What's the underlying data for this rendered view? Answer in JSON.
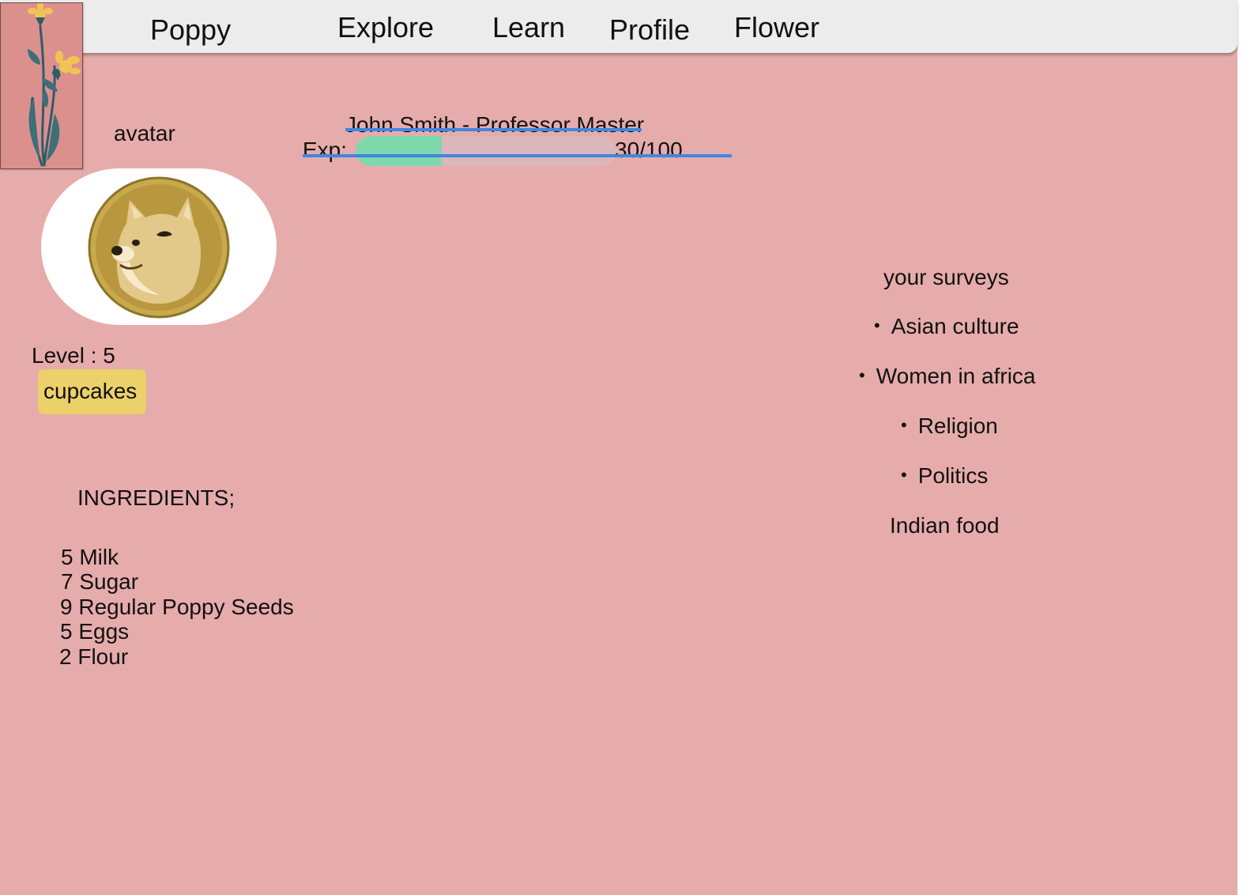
{
  "nav": {
    "brand": "Poppy",
    "items": [
      {
        "label": "Explore"
      },
      {
        "label": "Learn"
      },
      {
        "label": "Profile"
      },
      {
        "label": "Flower"
      }
    ]
  },
  "profile": {
    "avatar_label": "avatar",
    "name_title": "John Smith  - Professor Master",
    "exp_label": "Exp:",
    "exp_value": "30/100",
    "exp_fraction": 0.33,
    "level": "Level : 5",
    "badge": "cupcakes"
  },
  "ingredients": {
    "heading": "INGREDIENTS;",
    "items": [
      {
        "text": "5 Milk"
      },
      {
        "text": "7 Sugar"
      },
      {
        "text": "9 Regular Poppy Seeds"
      },
      {
        "text": "5 Eggs"
      },
      {
        "text": "2 Flour"
      }
    ]
  },
  "surveys": {
    "heading": "your surveys",
    "items": [
      {
        "label": "Asian culture"
      },
      {
        "label": "Women in africa"
      },
      {
        "label": "Religion"
      },
      {
        "label": "Politics"
      }
    ],
    "extra": "Indian food",
    "bullet": "•"
  },
  "colors": {
    "page_bg": "#e6acab",
    "navbar_bg": "#ececec",
    "logo_bg": "#db908e",
    "exp_fill": "#7fd8ab",
    "exp_track": "#dbb6bb",
    "underline": "#3f86e3",
    "badge_bg": "#ecd06a"
  },
  "icons": {
    "logo": "flower-logo-icon",
    "avatar": "doge-avatar-icon"
  }
}
